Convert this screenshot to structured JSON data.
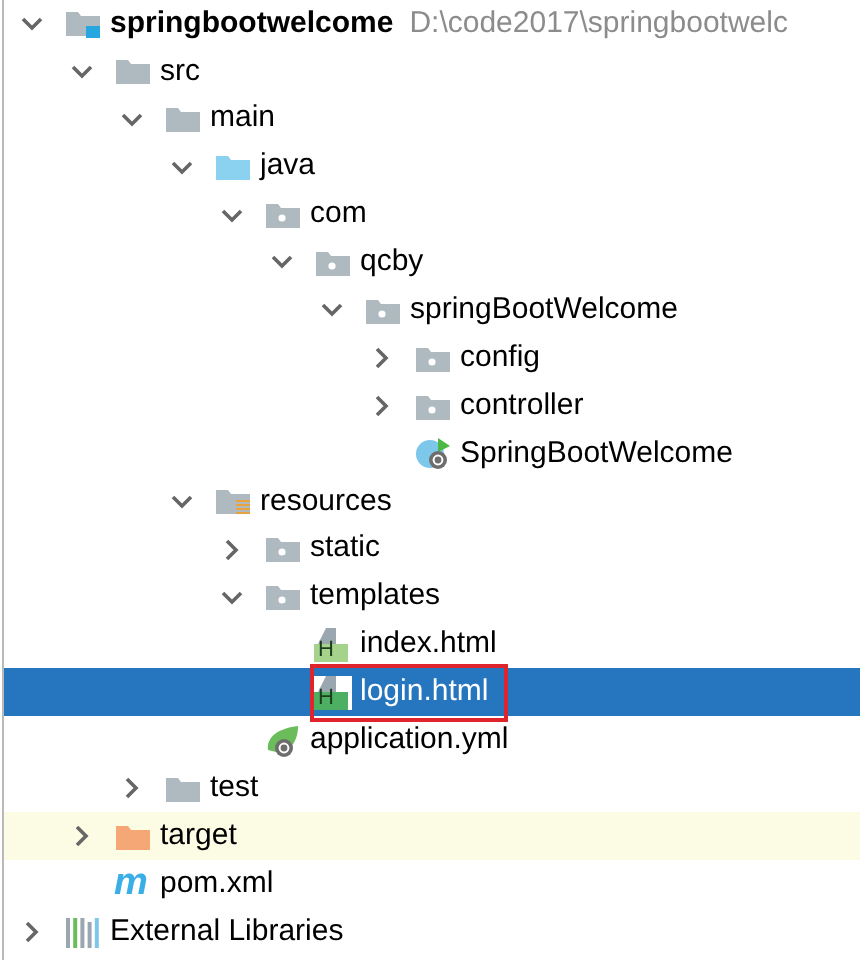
{
  "tree": [
    {
      "label": "springbootwelcome",
      "path": "D:\\code2017\\springbootwelc",
      "kind": "module",
      "expanded": true,
      "selected": false,
      "highlighted": false,
      "children": [
        {
          "label": "src",
          "kind": "folder",
          "expanded": true,
          "selected": false,
          "highlighted": false,
          "children": [
            {
              "label": "main",
              "kind": "folder",
              "expanded": true,
              "selected": false,
              "highlighted": false,
              "children": [
                {
                  "label": "java",
                  "kind": "source",
                  "expanded": true,
                  "selected": false,
                  "highlighted": false,
                  "children": [
                    {
                      "label": "com",
                      "kind": "package",
                      "expanded": true,
                      "selected": false,
                      "highlighted": false,
                      "children": [
                        {
                          "label": "qcby",
                          "kind": "package",
                          "expanded": true,
                          "selected": false,
                          "highlighted": false,
                          "children": [
                            {
                              "label": "springBootWelcome",
                              "kind": "package",
                              "expanded": true,
                              "selected": false,
                              "highlighted": false,
                              "children": [
                                {
                                  "label": "config",
                                  "kind": "package",
                                  "expanded": false,
                                  "selected": false,
                                  "highlighted": false
                                },
                                {
                                  "label": "controller",
                                  "kind": "package",
                                  "expanded": false,
                                  "selected": false,
                                  "highlighted": false
                                },
                                {
                                  "label": "SpringBootWelcome",
                                  "kind": "spring-class",
                                  "selected": false,
                                  "highlighted": false
                                }
                              ]
                            }
                          ]
                        }
                      ]
                    }
                  ]
                },
                {
                  "label": "resources",
                  "kind": "resources",
                  "expanded": true,
                  "selected": false,
                  "highlighted": false,
                  "children": [
                    {
                      "label": "static",
                      "kind": "package",
                      "expanded": false,
                      "selected": false,
                      "highlighted": false
                    },
                    {
                      "label": "templates",
                      "kind": "package",
                      "expanded": true,
                      "selected": false,
                      "highlighted": false,
                      "children": [
                        {
                          "label": "index.html",
                          "kind": "html",
                          "icon_text": "H",
                          "selected": false,
                          "highlighted": false,
                          "annotated": false
                        },
                        {
                          "label": "login.html",
                          "kind": "html",
                          "icon_text": "H",
                          "selected": true,
                          "highlighted": false,
                          "annotated": true
                        }
                      ]
                    },
                    {
                      "label": "application.yml",
                      "kind": "spring-config",
                      "selected": false,
                      "highlighted": false
                    }
                  ]
                }
              ]
            },
            {
              "label": "test",
              "kind": "folder",
              "expanded": false,
              "selected": false,
              "highlighted": false
            }
          ]
        },
        {
          "label": "target",
          "kind": "excluded",
          "expanded": false,
          "selected": false,
          "highlighted": true
        },
        {
          "label": "pom.xml",
          "kind": "maven",
          "icon_text": "m",
          "selected": false,
          "highlighted": false
        }
      ]
    },
    {
      "label": "External Libraries",
      "kind": "libraries",
      "expanded": false,
      "selected": false,
      "highlighted": false
    }
  ]
}
